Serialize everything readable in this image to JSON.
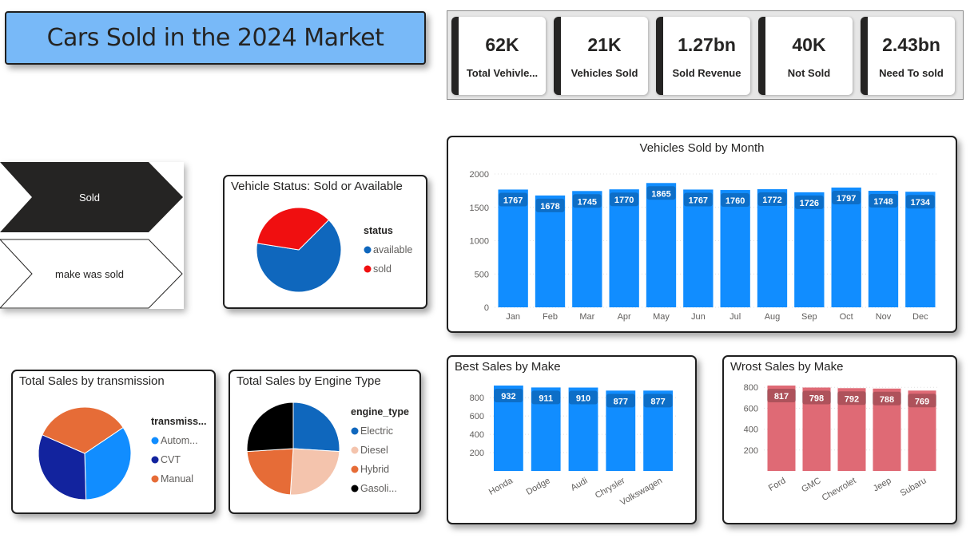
{
  "title": "Cars Sold in the 2024 Market",
  "kpis": [
    {
      "value": "62K",
      "label": "Total Vehivle..."
    },
    {
      "value": "21K",
      "label": "Vehicles Sold"
    },
    {
      "value": "1.27bn",
      "label": "Sold Revenue"
    },
    {
      "value": "40K",
      "label": "Not Sold"
    },
    {
      "value": "2.43bn",
      "label": "Need To sold"
    }
  ],
  "shapes": {
    "top_label": "Sold",
    "bottom_label": "make was sold"
  },
  "colors": {
    "blue": "#118dff",
    "dark_blue": "#12239e",
    "orange": "#e66c37",
    "red": "#f00f10",
    "mid_blue": "#0f67bd",
    "peach": "#f4c4ad",
    "black": "#000000",
    "rose": "#df6a75",
    "banner": "#78b9f8",
    "dark": "#252423"
  },
  "chart_data": [
    {
      "id": "status",
      "type": "pie",
      "title": "Vehicle Status: Sold or Available",
      "legend_title": "status",
      "labels": [
        "available",
        "sold"
      ],
      "values": [
        65,
        35
      ],
      "colors": [
        "#0f67bd",
        "#f00f10"
      ]
    },
    {
      "id": "transmission",
      "type": "pie",
      "title": "Total Sales by transmission",
      "legend_title": "transmiss...",
      "labels": [
        "Autom...",
        "CVT",
        "Manual"
      ],
      "values": [
        34,
        32,
        34
      ],
      "colors": [
        "#118dff",
        "#12239e",
        "#e66c37"
      ]
    },
    {
      "id": "engine",
      "type": "pie",
      "title": "Total Sales by Engine Type",
      "legend_title": "engine_type",
      "labels": [
        "Electric",
        "Diesel",
        "Hybrid",
        "Gasoli..."
      ],
      "values": [
        26,
        25,
        23,
        26
      ],
      "colors": [
        "#0f67bd",
        "#f4c4ad",
        "#e66c37",
        "#000000"
      ]
    },
    {
      "id": "monthly",
      "type": "bar",
      "title": "Vehicles Sold by Month",
      "categories": [
        "Jan",
        "Feb",
        "Mar",
        "Apr",
        "May",
        "Jun",
        "Jul",
        "Aug",
        "Sep",
        "Oct",
        "Nov",
        "Dec"
      ],
      "values": [
        1767,
        1678,
        1745,
        1770,
        1865,
        1767,
        1760,
        1772,
        1726,
        1797,
        1748,
        1734
      ],
      "yticks": [
        0,
        500,
        1000,
        1500,
        2000
      ],
      "ylim": [
        0,
        2000
      ],
      "color": "#118dff"
    },
    {
      "id": "best",
      "type": "bar",
      "title": "Best Sales by Make",
      "categories": [
        "Honda",
        "Dodge",
        "Audi",
        "Chrysler",
        "Volkswagen"
      ],
      "values": [
        932,
        911,
        910,
        877,
        877
      ],
      "yticks": [
        200,
        400,
        600,
        800
      ],
      "ylim": [
        0,
        932
      ],
      "color": "#118dff"
    },
    {
      "id": "worst",
      "type": "bar",
      "title": "Wrost Sales by Make",
      "categories": [
        "Ford",
        "GMC",
        "Chevrolet",
        "Jeep",
        "Subaru"
      ],
      "values": [
        817,
        798,
        792,
        788,
        769
      ],
      "yticks": [
        200,
        400,
        600,
        800
      ],
      "ylim": [
        0,
        817
      ],
      "color": "#df6a75"
    }
  ]
}
